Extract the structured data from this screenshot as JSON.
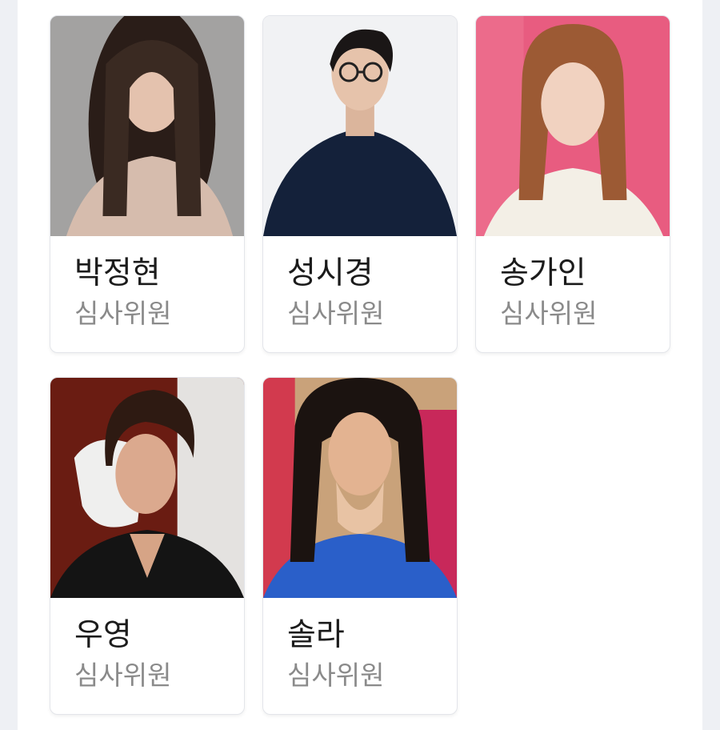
{
  "judges": [
    {
      "name": "박정현",
      "role": "심사위원",
      "accent": "#9c9a9a"
    },
    {
      "name": "성시경",
      "role": "심사위원",
      "accent": "#1c2a46"
    },
    {
      "name": "송가인",
      "role": "심사위원",
      "accent": "#e8567c"
    },
    {
      "name": "우영",
      "role": "심사위원",
      "accent": "#3a1a14"
    },
    {
      "name": "솔라",
      "role": "심사위원",
      "accent": "#2b62c9"
    }
  ]
}
